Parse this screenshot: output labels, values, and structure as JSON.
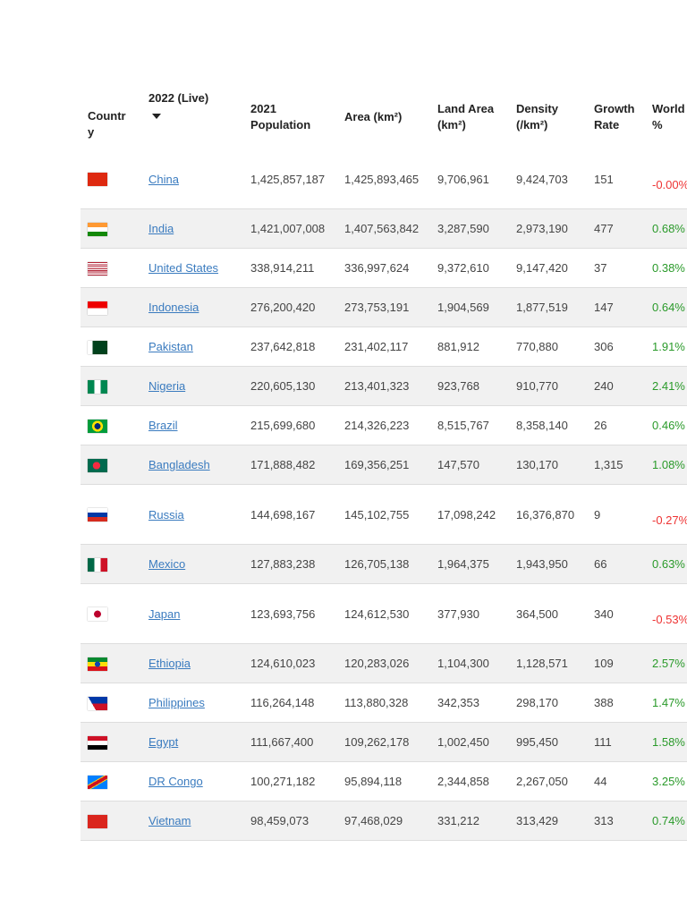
{
  "headers": {
    "country": "Countr y",
    "live": "2022 (Live)",
    "pop2021": "2021 Population",
    "area": "Area (km²)",
    "land_area": "Land Area (km²)",
    "density": "Density (/km²)",
    "growth": "Growth Rate",
    "world": "World %"
  },
  "rows": [
    {
      "flag": "cn",
      "name": "China",
      "c2": "1,425,857,187",
      "c3": "1,425,893,465",
      "c4": "9,706,961",
      "c5": "9,424,703",
      "c6": "151",
      "c7": "-0.00%"
    },
    {
      "flag": "in",
      "name": "India",
      "c2": "1,421,007,008",
      "c3": "1,407,563,842",
      "c4": "3,287,590",
      "c5": "2,973,190",
      "c6": "477",
      "c7": "0.68%"
    },
    {
      "flag": "us",
      "name": "United States",
      "c2": "338,914,211",
      "c3": "336,997,624",
      "c4": "9,372,610",
      "c5": "9,147,420",
      "c6": "37",
      "c7": "0.38%"
    },
    {
      "flag": "id",
      "name": "Indonesia",
      "c2": "276,200,420",
      "c3": "273,753,191",
      "c4": "1,904,569",
      "c5": "1,877,519",
      "c6": "147",
      "c7": "0.64%"
    },
    {
      "flag": "pk",
      "name": "Pakistan",
      "c2": "237,642,818",
      "c3": "231,402,117",
      "c4": "881,912",
      "c5": "770,880",
      "c6": "306",
      "c7": "1.91%"
    },
    {
      "flag": "ng",
      "name": "Nigeria",
      "c2": "220,605,130",
      "c3": "213,401,323",
      "c4": "923,768",
      "c5": "910,770",
      "c6": "240",
      "c7": "2.41%"
    },
    {
      "flag": "br",
      "name": "Brazil",
      "c2": "215,699,680",
      "c3": "214,326,223",
      "c4": "8,515,767",
      "c5": "8,358,140",
      "c6": "26",
      "c7": "0.46%"
    },
    {
      "flag": "bd",
      "name": "Bangladesh",
      "c2": "171,888,482",
      "c3": "169,356,251",
      "c4": "147,570",
      "c5": "130,170",
      "c6": "1,315",
      "c7": "1.08%"
    },
    {
      "flag": "ru",
      "name": "Russia",
      "c2": "144,698,167",
      "c3": "145,102,755",
      "c4": "17,098,242",
      "c5": "16,376,870",
      "c6": "9",
      "c7": "-0.27%"
    },
    {
      "flag": "mx",
      "name": "Mexico",
      "c2": "127,883,238",
      "c3": "126,705,138",
      "c4": "1,964,375",
      "c5": "1,943,950",
      "c6": "66",
      "c7": "0.63%"
    },
    {
      "flag": "jp",
      "name": "Japan",
      "c2": "123,693,756",
      "c3": "124,612,530",
      "c4": "377,930",
      "c5": "364,500",
      "c6": "340",
      "c7": "-0.53%"
    },
    {
      "flag": "et",
      "name": "Ethiopia",
      "c2": "124,610,023",
      "c3": "120,283,026",
      "c4": "1,104,300",
      "c5": "1,128,571",
      "c6": "109",
      "c7": "2.57%"
    },
    {
      "flag": "ph",
      "name": "Philippines",
      "c2": "116,264,148",
      "c3": "113,880,328",
      "c4": "342,353",
      "c5": "298,170",
      "c6": "388",
      "c7": "1.47%"
    },
    {
      "flag": "eg",
      "name": "Egypt",
      "c2": "111,667,400",
      "c3": "109,262,178",
      "c4": "1,002,450",
      "c5": "995,450",
      "c6": "111",
      "c7": "1.58%"
    },
    {
      "flag": "cd",
      "name": "DR Congo",
      "c2": "100,271,182",
      "c3": "95,894,118",
      "c4": "2,344,858",
      "c5": "2,267,050",
      "c6": "44",
      "c7": "3.25%"
    },
    {
      "flag": "vn",
      "name": "Vietnam",
      "c2": "98,459,073",
      "c3": "97,468,029",
      "c4": "331,212",
      "c5": "313,429",
      "c6": "313",
      "c7": "0.74%"
    }
  ]
}
